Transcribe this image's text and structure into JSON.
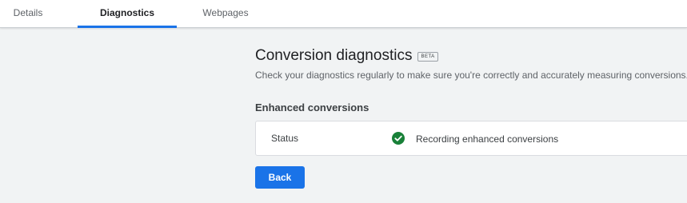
{
  "tabs": [
    {
      "label": "Details",
      "active": false
    },
    {
      "label": "Diagnostics",
      "active": true
    },
    {
      "label": "Webpages",
      "active": false
    }
  ],
  "main": {
    "title": "Conversion diagnostics",
    "badge": "BETA",
    "subtitle": "Check your diagnostics regularly to make sure you're correctly and accurately measuring conversions.",
    "section_heading": "Enhanced conversions",
    "status": {
      "label": "Status",
      "value": "Recording enhanced conversions",
      "icon": "check-circle-icon",
      "icon_color": "#188038"
    },
    "back_label": "Back"
  },
  "colors": {
    "accent": "#1a73e8",
    "background": "#f1f3f4",
    "success": "#188038"
  }
}
